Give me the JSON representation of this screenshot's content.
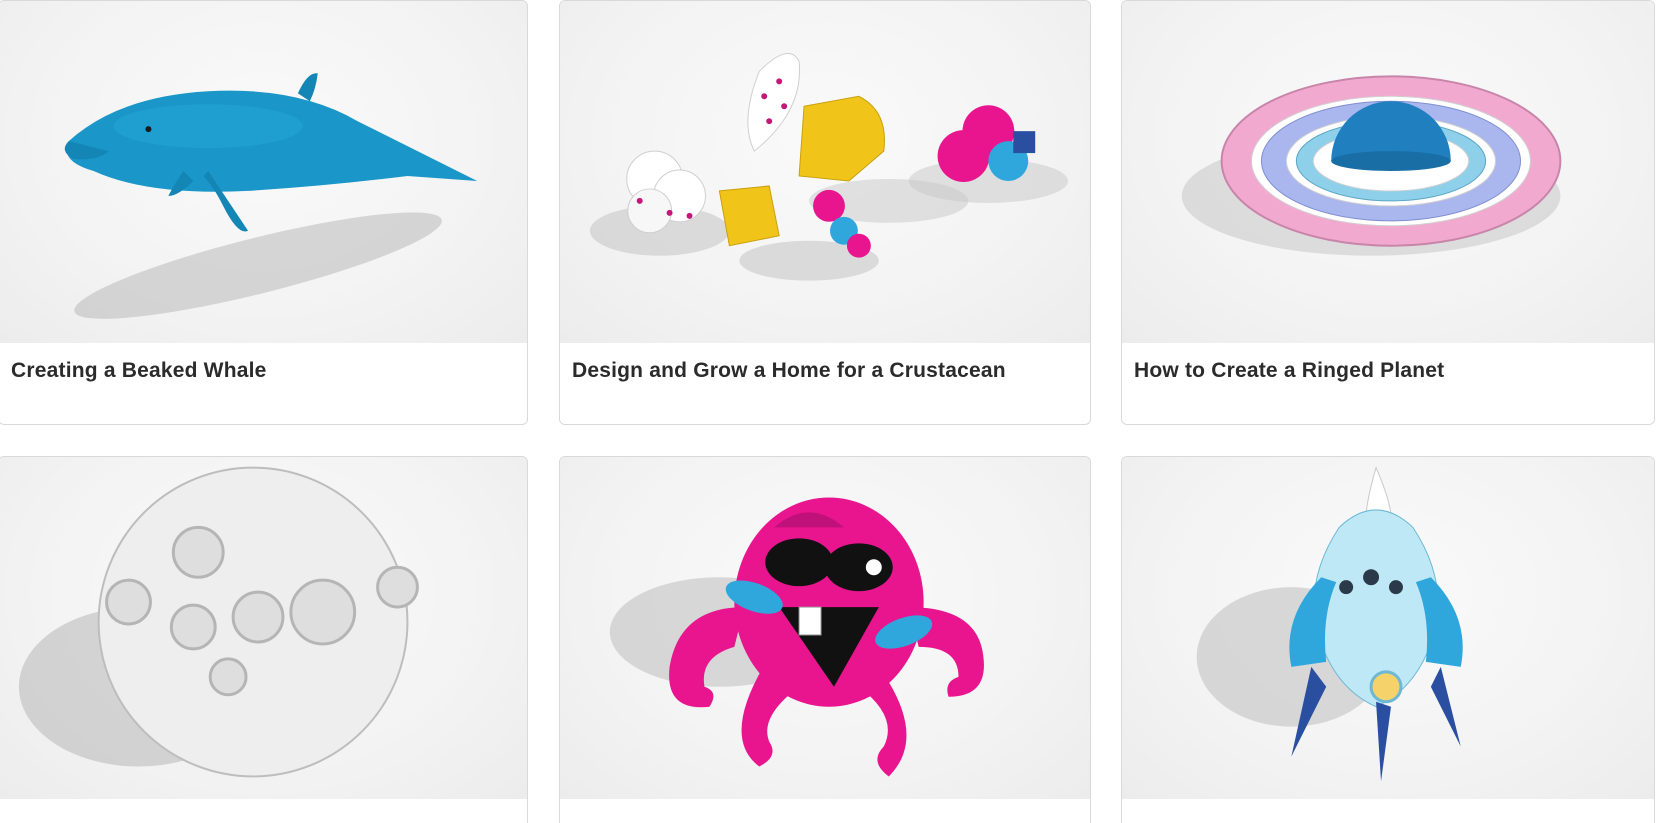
{
  "cards": [
    {
      "title": "Creating a Beaked Whale",
      "image": "beaked-whale-model"
    },
    {
      "title": "Design and Grow a Home for a Crustacean",
      "image": "crustacean-shells-model"
    },
    {
      "title": "How to Create a Ringed Planet",
      "image": "ringed-planet-model"
    },
    {
      "title": "",
      "image": "cratered-moon-model"
    },
    {
      "title": "",
      "image": "pink-octopus-model"
    },
    {
      "title": "",
      "image": "rocket-ship-model"
    }
  ],
  "colors": {
    "whale": "#1a96c8",
    "pink": "#e8158f",
    "yellow": "#f0c419",
    "blue": "#2fa7dc",
    "navy": "#2b4fa0",
    "moon": "#eeeeee",
    "ring_pink": "#f2a9d0",
    "ring_lavender": "#a9b7ee"
  }
}
